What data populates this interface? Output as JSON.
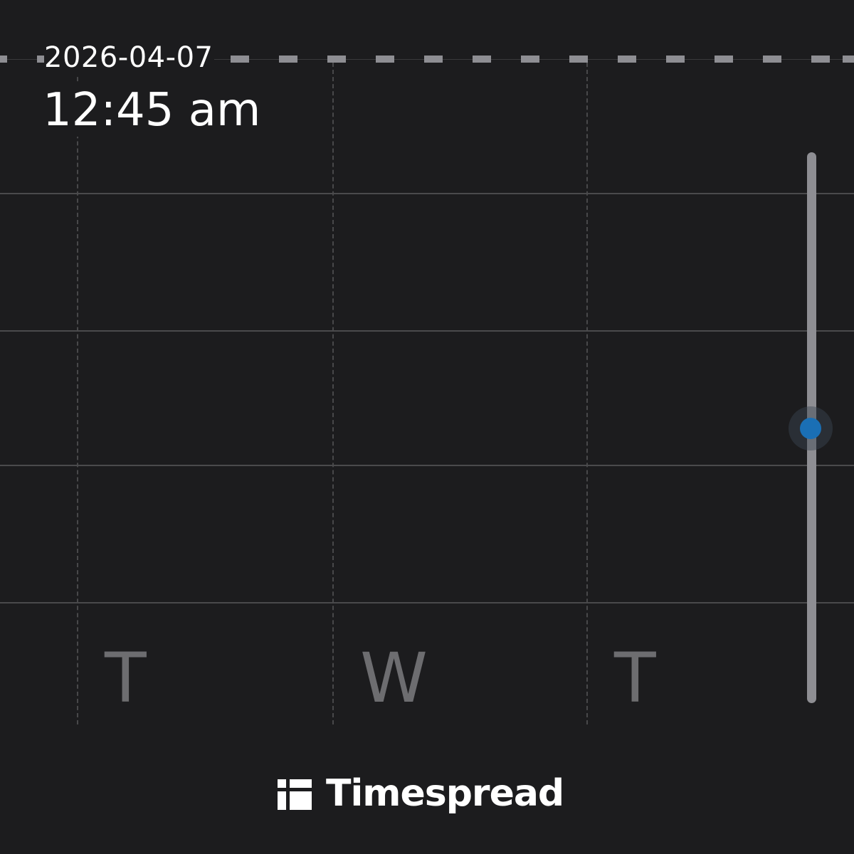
{
  "current_time_indicator": {
    "date": "2026-04-07",
    "time": "12:45 am"
  },
  "day_columns": [
    {
      "label": "T"
    },
    {
      "label": "W"
    },
    {
      "label": "T"
    }
  ],
  "scrollbar": {
    "thumb_color": "#1a6fb5",
    "track_color": "#8e8e93",
    "position_fraction": 0.5
  },
  "brand": {
    "icon": "timespread-logo-icon",
    "name": "Timespread"
  },
  "colors": {
    "background": "#1c1c1e",
    "text": "#ffffff",
    "day_label": "#6d6d70",
    "grid": "#4a4a4c"
  }
}
